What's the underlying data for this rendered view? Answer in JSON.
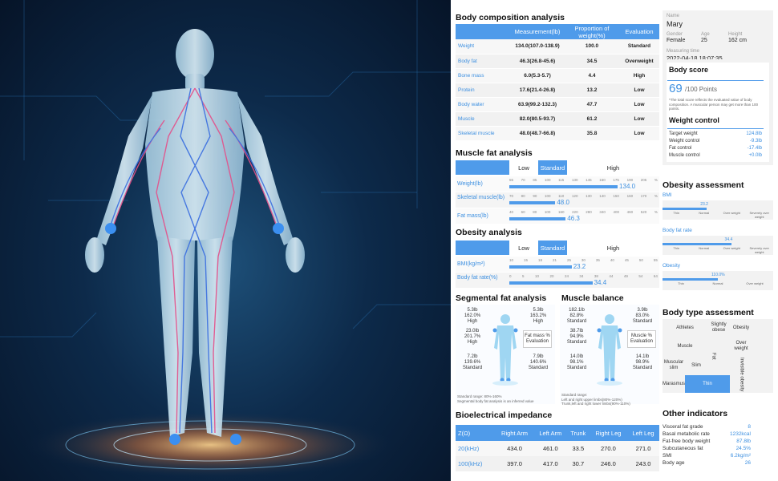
{
  "composition": {
    "title": "Body composition analysis",
    "headers": [
      "",
      "Measurement(lb)",
      "Proportion of weight(%)",
      "Evaluation"
    ],
    "rows": [
      [
        "Weight",
        "134.0(107.0-138.9)",
        "100.0",
        "Standard"
      ],
      [
        "Body fat",
        "46.3(26.8-45.6)",
        "34.5",
        "Overweight"
      ],
      [
        "Bone mass",
        "6.0(5.3-5.7)",
        "4.4",
        "High"
      ],
      [
        "Protein",
        "17.6(21.4-26.8)",
        "13.2",
        "Low"
      ],
      [
        "Body water",
        "63.9(99.2-132.3)",
        "47.7",
        "Low"
      ],
      [
        "Muscle",
        "82.0(80.5-93.7)",
        "61.2",
        "Low"
      ],
      [
        "Skeletal muscle",
        "48.0(48.7-66.8)",
        "35.8",
        "Low"
      ]
    ]
  },
  "profile": {
    "name_label": "Name",
    "name": "Mary",
    "gender_label": "Gender",
    "gender": "Female",
    "age_label": "Age",
    "age": "25",
    "height_label": "Height",
    "height": "162 cm",
    "time_label": "Measuring time",
    "time": "2022-04-18 18:07:35"
  },
  "score": {
    "title": "Body score",
    "value": "69",
    "unit": "/100 Points",
    "note": "*The total score reflects the evaluated value of body composition. A muscular person may get more than 100 points."
  },
  "weight_control": {
    "title": "Weight control",
    "rows": [
      [
        "Target weight",
        "124.8lb"
      ],
      [
        "Weight control",
        "-9.3lb"
      ],
      [
        "Fat control",
        "-17.4lb"
      ],
      [
        "Muscle control",
        "+0.0lb"
      ]
    ]
  },
  "muscle_fat": {
    "title": "Muscle fat analysis",
    "cats": [
      "Low",
      "Standard",
      "High"
    ],
    "rows": [
      {
        "label": "Weight(lb)",
        "value": "134.0",
        "ticks": [
          "55",
          "70",
          "85",
          "100",
          "115",
          "130",
          "145",
          "160",
          "175",
          "190",
          "205",
          "%"
        ],
        "pct": 0.73
      },
      {
        "label": "Skeletal muscle(lb)",
        "value": "48.0",
        "ticks": [
          "70",
          "80",
          "90",
          "100",
          "110",
          "120",
          "130",
          "140",
          "150",
          "160",
          "170",
          "%"
        ],
        "pct": 0.31
      },
      {
        "label": "Fat mass(lb)",
        "value": "46.3",
        "ticks": [
          "40",
          "60",
          "80",
          "100",
          "160",
          "220",
          "280",
          "340",
          "400",
          "460",
          "520",
          "%"
        ],
        "pct": 0.38
      }
    ]
  },
  "obesity": {
    "title": "Obesity analysis",
    "cats": [
      "Low",
      "Standard",
      "High"
    ],
    "rows": [
      {
        "label": "BMI(kg/m²)",
        "value": "23.2",
        "ticks": [
          "10",
          "15",
          "18",
          "21",
          "25",
          "30",
          "35",
          "40",
          "45",
          "50",
          "55"
        ],
        "pct": 0.42
      },
      {
        "label": "Body fat rate(%)",
        "value": "34.4",
        "ticks": [
          "0",
          "5",
          "10",
          "20",
          "24",
          "34",
          "38",
          "44",
          "49",
          "54",
          "64"
        ],
        "pct": 0.56
      }
    ]
  },
  "obesity_assessment": {
    "title": "Obesity assessment",
    "items": [
      {
        "label": "BMI",
        "value": "23.2",
        "cats": [
          "Thin",
          "Normal",
          "Over weight",
          "Severely over weight"
        ],
        "pct": 0.4
      },
      {
        "label": "Body fat rate",
        "value": "34.4",
        "cats": [
          "Thin",
          "Normal",
          "Over weight",
          "Severely over weight"
        ],
        "pct": 0.62
      },
      {
        "label": "Obesity",
        "value": "110.0%",
        "cats": [
          "Thin",
          "Normal",
          "Over weight"
        ],
        "pct": 0.5
      }
    ]
  },
  "segmental": {
    "title": "Segmental fat analysis",
    "left_arm": [
      "5.3lb",
      "162.0%",
      "High"
    ],
    "right_arm": [
      "5.3lb",
      "163.2%",
      "High"
    ],
    "trunk": [
      "23.0lb",
      "201.7%",
      "High"
    ],
    "left_leg": [
      "7.2lb",
      "139.6%",
      "Standard"
    ],
    "right_leg": [
      "7.9lb",
      "140.6%",
      "Standard"
    ],
    "center_label": "Fat mass % Evaluation",
    "footer": [
      "Standard range: 80%-160%",
      "Segmental body fat analysis is an inferred value"
    ]
  },
  "muscle_balance": {
    "title": "Muscle balance",
    "left_arm": [
      "182.1lb",
      "82.8%",
      "Standard"
    ],
    "right_arm": [
      "3.9lb",
      "83.0%",
      "Standard"
    ],
    "trunk": [
      "38.7lb",
      "94.9%",
      "Standard"
    ],
    "left_leg": [
      "14.0lb",
      "98.1%",
      "Standard"
    ],
    "right_leg": [
      "14.1lb",
      "98.9%",
      "Standard"
    ],
    "center_label": "Muscle % Evaluation",
    "footer": [
      "Standard range:",
      "Left and right upper limbs(80%-120%)",
      "Trunk,left and right lower limbs(90%-110%)"
    ]
  },
  "body_type": {
    "title": "Body type assessment",
    "cells": [
      "Athletes",
      "Slightly obese",
      "Obesity",
      "Muscle",
      "Over weight",
      "Muscular slim",
      "Slim",
      "Marasmus",
      "Thin",
      "Fat",
      "Invisible obesity"
    ]
  },
  "impedance": {
    "title": "Bioelectrical impedance",
    "headers": [
      "Z(Ω)",
      "Right Arm",
      "Left Arm",
      "Trunk",
      "Right Leg",
      "Left Leg"
    ],
    "rows": [
      [
        "20(kHz)",
        "434.0",
        "461.0",
        "33.5",
        "270.0",
        "271.0"
      ],
      [
        "100(kHz)",
        "397.0",
        "417.0",
        "30.7",
        "246.0",
        "243.0"
      ]
    ]
  },
  "other": {
    "title": "Other indicators",
    "rows": [
      [
        "Visceral fat grade",
        "8"
      ],
      [
        "Basal metabolic rate",
        "1232kcal"
      ],
      [
        "Fat-free body weight",
        "87.8lb"
      ],
      [
        "Subcutaneous fat",
        "24.5%"
      ],
      [
        "SMI",
        "6.2kg/m²"
      ],
      [
        "Body age",
        "26"
      ]
    ]
  },
  "colors": {
    "accent": "#4f9bea",
    "hero_bg": "#0d2a4a"
  }
}
